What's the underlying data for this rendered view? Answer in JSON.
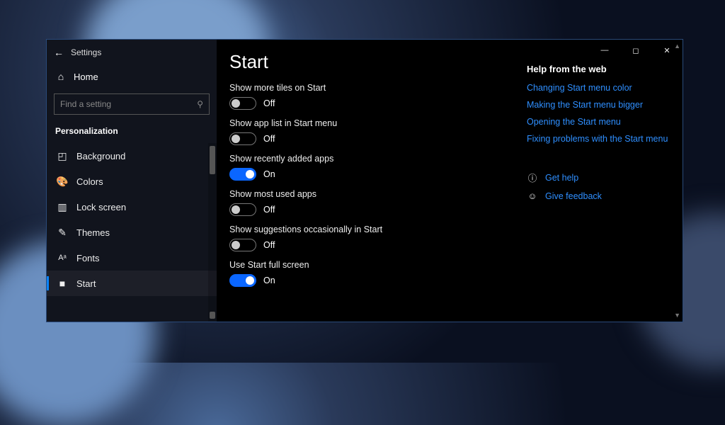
{
  "window": {
    "title": "Settings"
  },
  "sidebar": {
    "home": "Home",
    "search_placeholder": "Find a setting",
    "category": "Personalization",
    "items": [
      {
        "icon": "background-icon",
        "label": "Background"
      },
      {
        "icon": "colors-icon",
        "label": "Colors"
      },
      {
        "icon": "lockscreen-icon",
        "label": "Lock screen"
      },
      {
        "icon": "themes-icon",
        "label": "Themes"
      },
      {
        "icon": "fonts-icon",
        "label": "Fonts"
      },
      {
        "icon": "start-icon",
        "label": "Start",
        "active": true
      }
    ]
  },
  "page": {
    "heading": "Start",
    "settings": [
      {
        "label": "Show more tiles on Start",
        "on": false
      },
      {
        "label": "Show app list in Start menu",
        "on": false
      },
      {
        "label": "Show recently added apps",
        "on": true
      },
      {
        "label": "Show most used apps",
        "on": false
      },
      {
        "label": "Show suggestions occasionally in Start",
        "on": false
      },
      {
        "label": "Use Start full screen",
        "on": true
      }
    ],
    "state_labels": {
      "on": "On",
      "off": "Off"
    }
  },
  "help": {
    "heading": "Help from the web",
    "links": [
      "Changing Start menu color",
      "Making the Start menu bigger",
      "Opening the Start menu",
      "Fixing problems with the Start menu"
    ],
    "get_help": "Get help",
    "give_feedback": "Give feedback"
  }
}
